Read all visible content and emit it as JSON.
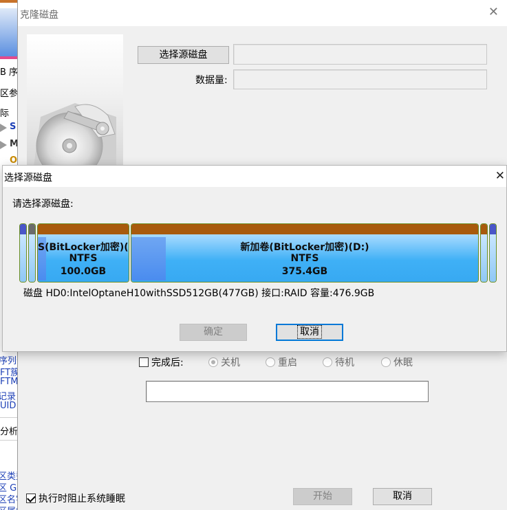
{
  "background_app": {
    "fragments": [
      "B 序",
      "区参",
      "际",
      "S",
      "M",
      "O",
      "序列号",
      "FT簇",
      "FTM",
      "记录",
      "UID",
      "分析",
      "区类型",
      "区 GU",
      "区名字",
      "区属性"
    ]
  },
  "clone_window": {
    "title": "克隆磁盘",
    "close_glyph": "✕",
    "select_source_button": "选择源磁盘",
    "source_value": "",
    "data_amount_label": "数据量:",
    "data_amount_value": "",
    "after_done_label": "完成后:",
    "after_done_checked": false,
    "after_options": [
      {
        "label": "关机",
        "selected": true
      },
      {
        "label": "重启",
        "selected": false
      },
      {
        "label": "待机",
        "selected": false
      },
      {
        "label": "休眠",
        "selected": false
      }
    ],
    "status_value": "",
    "prevent_sleep_label": "执行时阻止系统睡眠",
    "prevent_sleep_checked": true,
    "start_button": "开始",
    "cancel_button": "取消"
  },
  "source_dialog": {
    "title": "选择源磁盘",
    "close_glyph": "✕",
    "prompt": "请选择源磁盘:",
    "partitions": [
      {
        "name": "",
        "fs": "",
        "size": "",
        "color": "#4a56c8"
      },
      {
        "name": "",
        "fs": "",
        "size": "",
        "color": "#6b6b6b"
      },
      {
        "name": "S(BitLocker加密)(C",
        "fs": "NTFS",
        "size": "100.0GB",
        "color": "#a85a0c"
      },
      {
        "name": "新加卷(BitLocker加密)(D:)",
        "fs": "NTFS",
        "size": "375.4GB",
        "color": "#a85a0c"
      },
      {
        "name": "",
        "fs": "",
        "size": "",
        "color": "#a85a0c"
      },
      {
        "name": "",
        "fs": "",
        "size": "",
        "color": "#4a56c8"
      }
    ],
    "disk_info": "磁盘 HD0:IntelOptaneH10withSSD512GB(477GB)  接口:RAID  容量:476.9GB",
    "ok_button": "确定",
    "cancel_button": "取消"
  }
}
